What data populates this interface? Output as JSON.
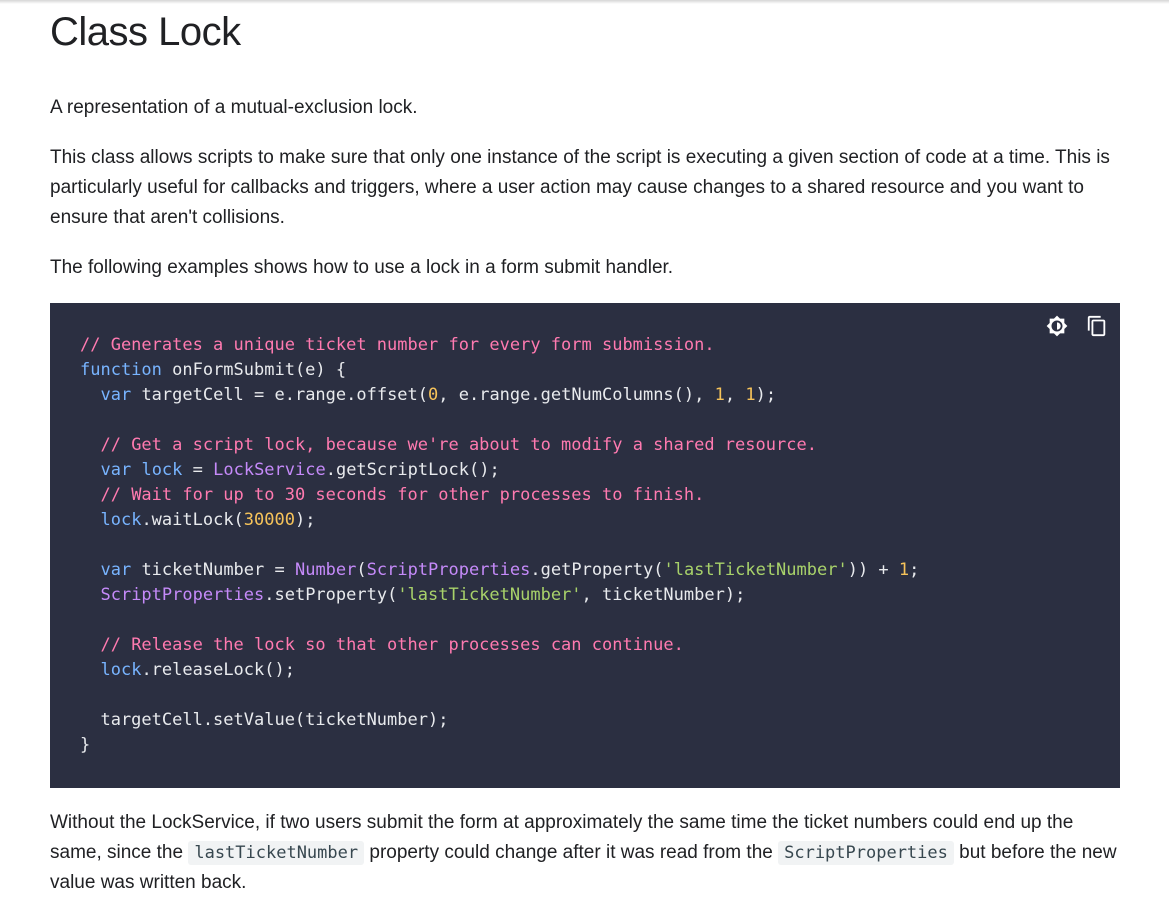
{
  "title": "Class Lock",
  "intro": "A representation of a mutual-exclusion lock.",
  "description": "This class allows scripts to make sure that only one instance of the script is executing a given section of code at a time. This is particularly useful for callbacks and triggers, where a user action may cause changes to a shared resource and you want to ensure that aren't collisions.",
  "example_intro": "The following examples shows how to use a lock in a form submit handler.",
  "code": {
    "toolbar": {
      "theme_icon": "brightness-icon",
      "copy_icon": "copy-icon"
    },
    "lines": [
      "// Generates a unique ticket number for every form submission.",
      "function onFormSubmit(e) {",
      "  var targetCell = e.range.offset(0, e.range.getNumColumns(), 1, 1);",
      "",
      "  // Get a script lock, because we're about to modify a shared resource.",
      "  var lock = LockService.getScriptLock();",
      "  // Wait for up to 30 seconds for other processes to finish.",
      "  lock.waitLock(30000);",
      "",
      "  var ticketNumber = Number(ScriptProperties.getProperty('lastTicketNumber')) + 1;",
      "  ScriptProperties.setProperty('lastTicketNumber', ticketNumber);",
      "",
      "  // Release the lock so that other processes can continue.",
      "  lock.releaseLock();",
      "",
      "  targetCell.setValue(ticketNumber);",
      "}"
    ]
  },
  "footer": {
    "part1": "Without the LockService, if two users submit the form at approximately the same time the ticket numbers could end up the same, since the ",
    "code1": "lastTicketNumber",
    "part2": " property could change after it was read from the ",
    "code2": "ScriptProperties",
    "part3": " but before the new value was written back."
  },
  "colors": {
    "code_background": "#2b2f41",
    "comment": "#ff7ab0",
    "keyword": "#78b4ff",
    "number": "#f6c35a",
    "string": "#a8d26a",
    "class_name": "#c58af9"
  }
}
